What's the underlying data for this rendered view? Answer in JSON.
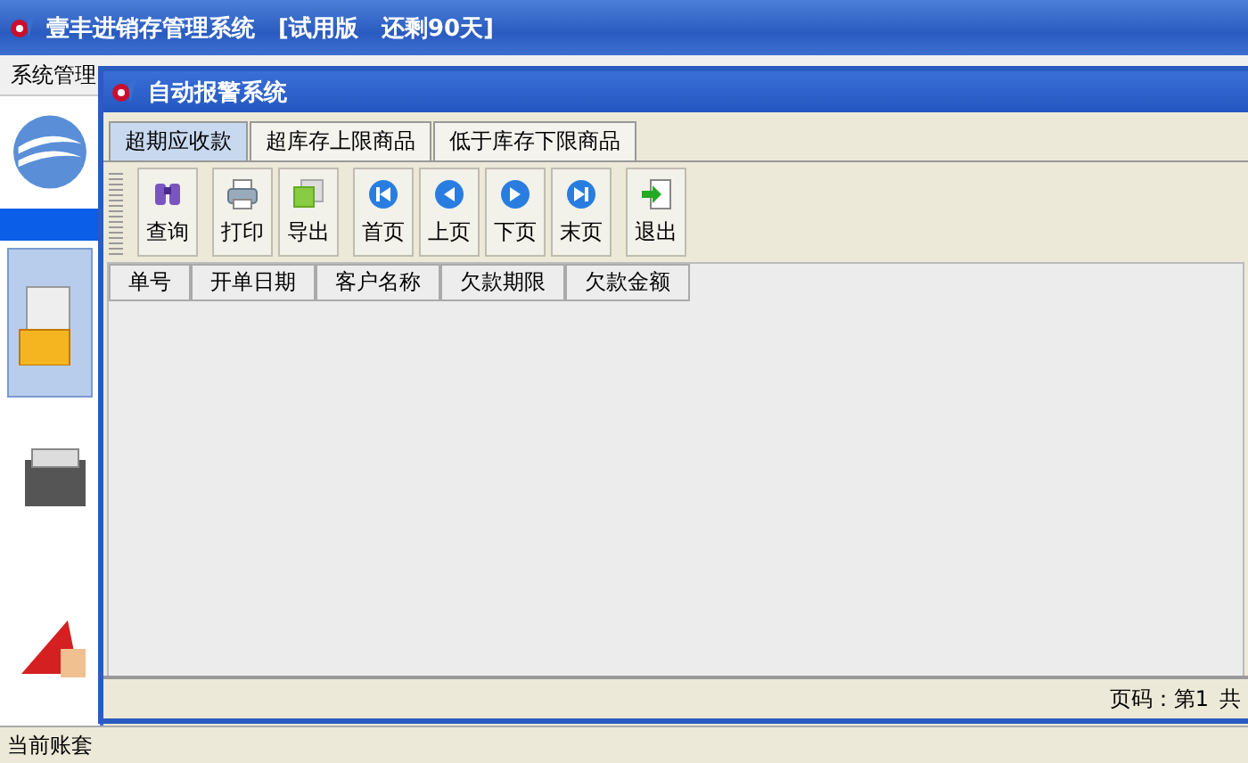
{
  "window": {
    "title": "壹丰进销存管理系统　[试用版　还剩90天]"
  },
  "menu": [
    "系统管理"
  ],
  "sidebar": {
    "items": [
      {
        "kind": "box",
        "selected": true
      },
      {
        "kind": "printer",
        "selected": false
      },
      {
        "kind": "flag",
        "selected": false
      }
    ]
  },
  "status_bar": {
    "text": "当前账套"
  },
  "child_window": {
    "title": "自动报警系统",
    "tabs": [
      {
        "label": "超期应收款",
        "selected": true
      },
      {
        "label": "超库存上限商品",
        "selected": false
      },
      {
        "label": "低于库存下限商品",
        "selected": false
      }
    ],
    "toolbar": [
      [
        {
          "label": "查询",
          "kind": "binoculars"
        }
      ],
      [
        {
          "label": "打印",
          "kind": "printer"
        },
        {
          "label": "导出",
          "kind": "export"
        }
      ],
      [
        {
          "label": "首页",
          "kind": "first"
        },
        {
          "label": "上页",
          "kind": "prev"
        },
        {
          "label": "下页",
          "kind": "next"
        },
        {
          "label": "末页",
          "kind": "last"
        }
      ],
      [
        {
          "label": "退出",
          "kind": "exit"
        }
      ]
    ],
    "table": {
      "columns": [
        "单号",
        "开单日期",
        "客户名称",
        "欠款期限",
        "欠款金额"
      ]
    },
    "status_bar": [
      "页码：第1",
      "共"
    ]
  }
}
